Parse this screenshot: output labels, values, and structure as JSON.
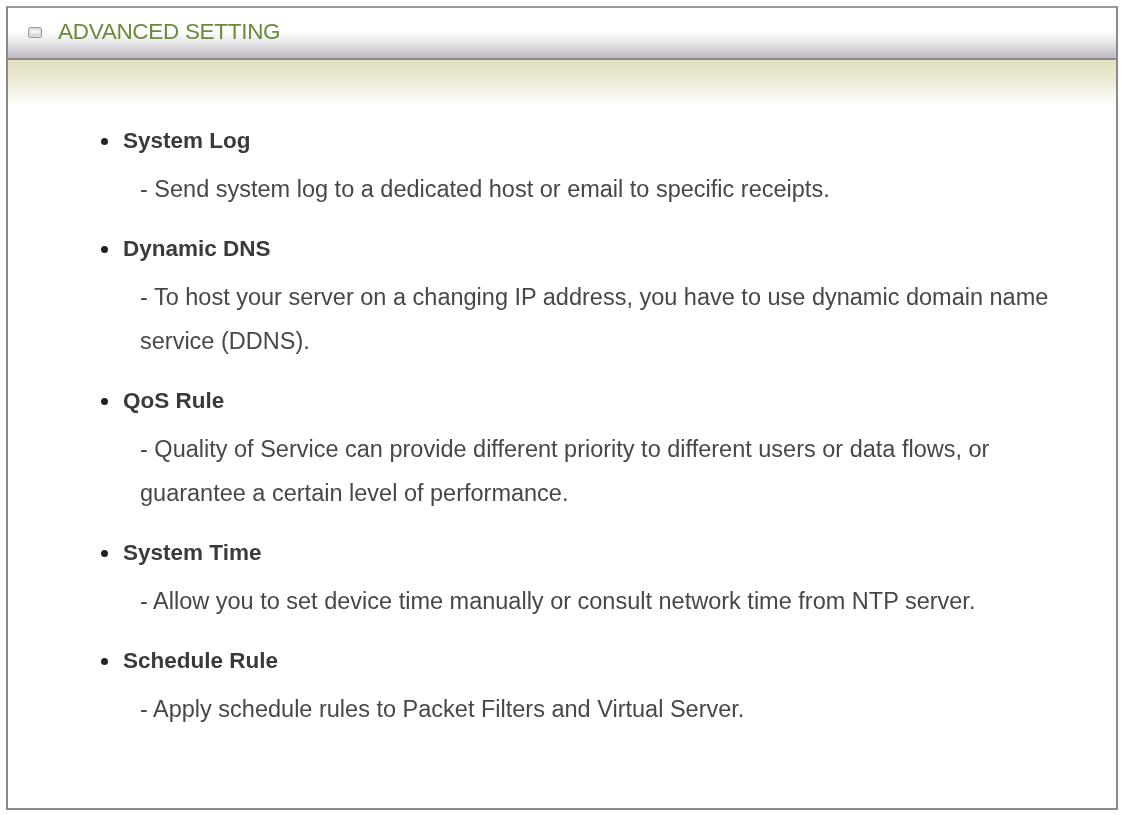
{
  "panel": {
    "title": "ADVANCED SETTING"
  },
  "items": [
    {
      "heading": "System Log",
      "description": "- Send system log to a dedicated host or email to specific receipts."
    },
    {
      "heading": "Dynamic DNS",
      "description": "- To host your server on a changing IP address, you have to use dynamic domain name service (DDNS)."
    },
    {
      "heading": "QoS Rule",
      "description": "- Quality of Service can provide different priority to different users or data flows, or guarantee a certain level of performance."
    },
    {
      "heading": "System Time",
      "description": "- Allow you to set device time manually or consult network time from NTP server."
    },
    {
      "heading": "Schedule Rule",
      "description": "- Apply schedule rules to Packet Filters and Virtual Server."
    }
  ]
}
